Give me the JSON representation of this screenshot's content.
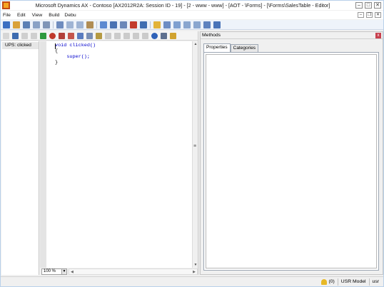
{
  "window": {
    "title": "Microsoft Dynamics AX - Contoso [AX2012R2A: Session ID - 19] - [2 - www - www] - [AOT - \\Forms] - [\\Forms\\SalesTable - Editor]",
    "minimize": "–",
    "maximize": "□",
    "close": "✕"
  },
  "menu": {
    "items": [
      "File",
      "Edit",
      "View",
      "Build",
      "Debu"
    ],
    "mdi_minimize": "–",
    "mdi_restore": "❐",
    "mdi_close": "✕"
  },
  "methods_list": {
    "items": [
      "UPS: clicked"
    ]
  },
  "editor": {
    "lines": [
      "void clicked()",
      "{",
      "    super();",
      "}"
    ],
    "zoom": "100 %"
  },
  "right_panel": {
    "title": "Methods",
    "tabs": [
      "Properties",
      "Categories"
    ],
    "active_tab": 0
  },
  "status": {
    "notifications": "(0)",
    "model": "USR Model",
    "layer": "usr"
  },
  "colors": {
    "accent": "#0000cc",
    "titlebar": "#ffffff",
    "toolbar": "#eef3fa"
  }
}
